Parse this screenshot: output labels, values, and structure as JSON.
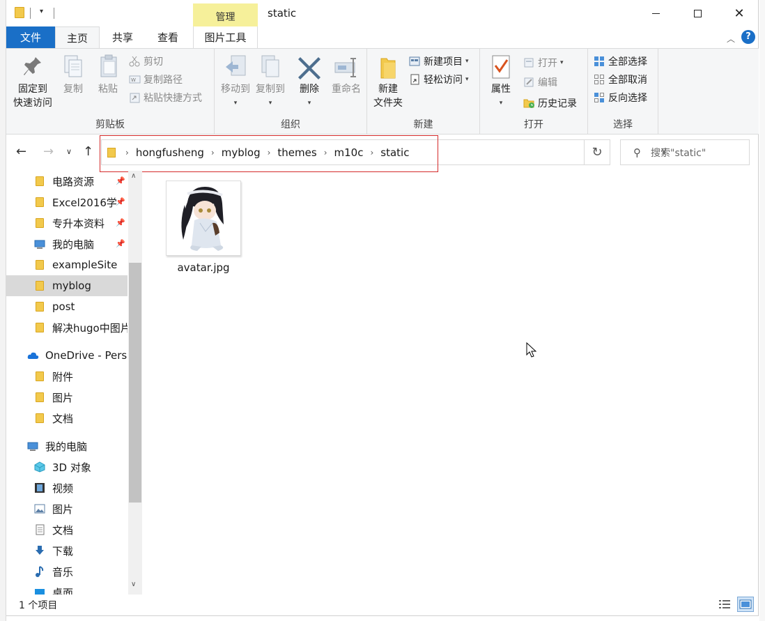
{
  "window": {
    "title": "static",
    "contextual_tab": "管理"
  },
  "ribbon_tabs": {
    "file": "文件",
    "home": "主页",
    "share": "共享",
    "view": "查看",
    "picture_tools": "图片工具"
  },
  "ribbon": {
    "clipboard": {
      "label": "剪贴板",
      "pin_quick_access": "固定到\n快速访问",
      "pin_line1": "固定到",
      "pin_line2": "快速访问",
      "copy": "复制",
      "paste": "粘贴",
      "cut": "剪切",
      "copy_path": "复制路径",
      "paste_shortcut": "粘贴快捷方式"
    },
    "organize": {
      "label": "组织",
      "move_to": "移动到",
      "copy_to": "复制到",
      "delete": "删除",
      "rename": "重命名"
    },
    "new": {
      "label": "新建",
      "new_folder_line1": "新建",
      "new_folder_line2": "文件夹",
      "new_item": "新建项目",
      "easy_access": "轻松访问"
    },
    "open": {
      "label": "打开",
      "properties": "属性",
      "open": "打开",
      "edit": "编辑",
      "history": "历史记录"
    },
    "select": {
      "label": "选择",
      "select_all": "全部选择",
      "select_none": "全部取消",
      "invert": "反向选择"
    }
  },
  "address": {
    "breadcrumbs": [
      "hongfusheng",
      "myblog",
      "themes",
      "m10c",
      "static"
    ],
    "search_placeholder": "搜索\"static\""
  },
  "nav_pane": {
    "quick_access": [
      {
        "label": "电路资源",
        "pinned": true
      },
      {
        "label": "Excel2016学",
        "pinned": true
      },
      {
        "label": "专升本资料",
        "pinned": true
      },
      {
        "label": "我的电脑",
        "pinned": true
      },
      {
        "label": "exampleSite",
        "pinned": false
      },
      {
        "label": "myblog",
        "pinned": false,
        "selected": true
      },
      {
        "label": "post",
        "pinned": false
      },
      {
        "label": "解决hugo中图片",
        "pinned": false
      }
    ],
    "onedrive": {
      "label": "OneDrive - Perso",
      "items": [
        "附件",
        "图片",
        "文档"
      ]
    },
    "this_pc": {
      "label": "我的电脑",
      "items": [
        "3D 对象",
        "视频",
        "图片",
        "文档",
        "下载",
        "音乐",
        "桌面"
      ]
    }
  },
  "files": [
    {
      "name": "avatar.jpg"
    }
  ],
  "status": {
    "item_count": "1 个项目"
  },
  "colors": {
    "accent": "#1a6fc7",
    "manage_tab": "#f6f09a",
    "folder": "#f2c94c",
    "highlight_box": "#d42a2a"
  }
}
